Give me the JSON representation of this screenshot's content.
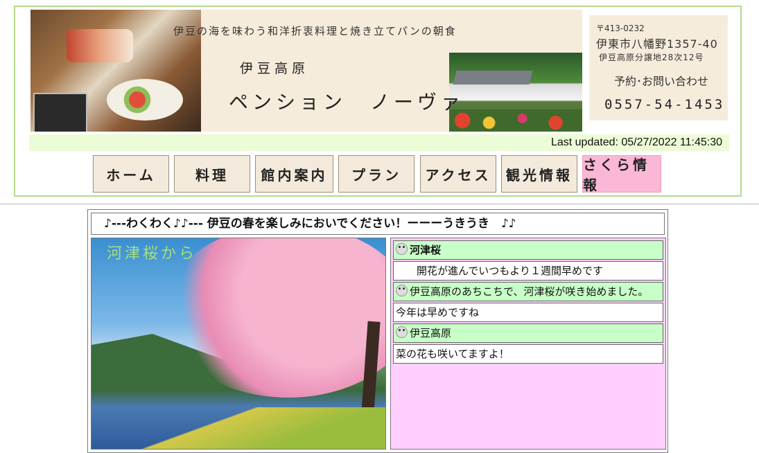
{
  "header": {
    "tagline": "伊豆の海を味わう和洋折衷料理と焼き立てパンの朝食",
    "sub_name": "伊豆高原",
    "pension_name": "ペンション　ノーヴァ",
    "contact": {
      "postal": "〒413-0232",
      "address_line1": "伊東市八幡野1357-40",
      "address_line2": "伊豆高原分譲地28次12号",
      "inquiry_label": "予約･お問い合わせ",
      "phone": "0557-54-1453"
    },
    "last_updated": "Last updated: 05/27/2022 11:45:30"
  },
  "nav": [
    {
      "label": "ホーム"
    },
    {
      "label": "料理"
    },
    {
      "label": "館内案内"
    },
    {
      "label": "プラン"
    },
    {
      "label": "アクセス"
    },
    {
      "label": "観光情報"
    },
    {
      "label": "さくら情報"
    }
  ],
  "content": {
    "headline": "♪---わくわく♪♪--- 伊豆の春を楽しみにおいでください！ーーーうきうき　♪♪",
    "photo_overlay": "河津桜から",
    "news": [
      {
        "kind": "title",
        "icon": "dog-icon",
        "text": "河津桜"
      },
      {
        "kind": "body",
        "icon": "",
        "text": "　　開花が進んでいつもより１週間早めです"
      },
      {
        "kind": "title",
        "icon": "dog-icon",
        "text": "伊豆高原のあちこちで、河津桜が咲き始めました。"
      },
      {
        "kind": "body",
        "icon": "",
        "text": "今年は早めですね"
      },
      {
        "kind": "title",
        "icon": "dog-icon",
        "text": "伊豆高原"
      },
      {
        "kind": "body",
        "icon": "",
        "text": " 菜の花も咲いてますよ！"
      }
    ]
  }
}
